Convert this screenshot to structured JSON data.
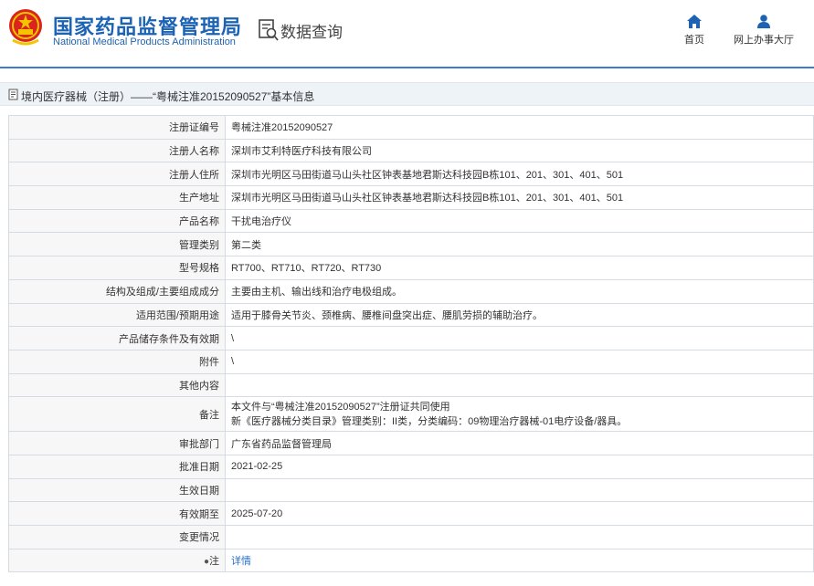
{
  "header": {
    "org_name_cn": "国家药品监督管理局",
    "org_name_en": "National Medical Products Administration",
    "query_title": "数据查询",
    "nav": {
      "home": "首页",
      "service_hall": "网上办事大厅"
    }
  },
  "breadcrumb": {
    "text": "境内医疗器械（注册）——“粤械注准20152090527”基本信息"
  },
  "colors": {
    "brand_blue": "#1d63b3",
    "link_blue": "#2a6fc9",
    "label_bg": "#f7f7f7",
    "crumb_bg": "#eef3f8"
  },
  "rows": [
    {
      "label": "注册证编号",
      "value": "粤械注准20152090527"
    },
    {
      "label": "注册人名称",
      "value": "深圳市艾利特医疗科技有限公司"
    },
    {
      "label": "注册人住所",
      "value": "深圳市光明区马田街道马山头社区钟表基地君斯达科技园B栋101、201、301、401、501"
    },
    {
      "label": "生产地址",
      "value": "深圳市光明区马田街道马山头社区钟表基地君斯达科技园B栋101、201、301、401、501"
    },
    {
      "label": "产品名称",
      "value": "干扰电治疗仪"
    },
    {
      "label": "管理类别",
      "value": "第二类"
    },
    {
      "label": "型号规格",
      "value": "RT700、RT710、RT720、RT730"
    },
    {
      "label": "结构及组成/主要组成成分",
      "value": "主要由主机、输出线和治疗电极组成。"
    },
    {
      "label": "适用范围/预期用途",
      "value": "适用于膝骨关节炎、颈椎病、腰椎间盘突出症、腰肌劳损的辅助治疗。"
    },
    {
      "label": "产品储存条件及有效期",
      "value": "\\"
    },
    {
      "label": "附件",
      "value": "\\"
    },
    {
      "label": "其他内容",
      "value": ""
    }
  ],
  "remark": {
    "label": "备注",
    "line1": "本文件与“粤械注准20152090527”注册证共同使用",
    "line2": "新《医疗器械分类目录》管理类别：II类，分类编码：09物理治疗器械-01电疗设备/器具。"
  },
  "rows_after": [
    {
      "label": "审批部门",
      "value": "广东省药品监督管理局"
    },
    {
      "label": "批准日期",
      "value": "2021-02-25"
    },
    {
      "label": "生效日期",
      "value": ""
    },
    {
      "label": "有效期至",
      "value": "2025-07-20"
    },
    {
      "label": "变更情况",
      "value": ""
    }
  ],
  "note": {
    "pin": "●",
    "label": "注",
    "link": "详情"
  }
}
